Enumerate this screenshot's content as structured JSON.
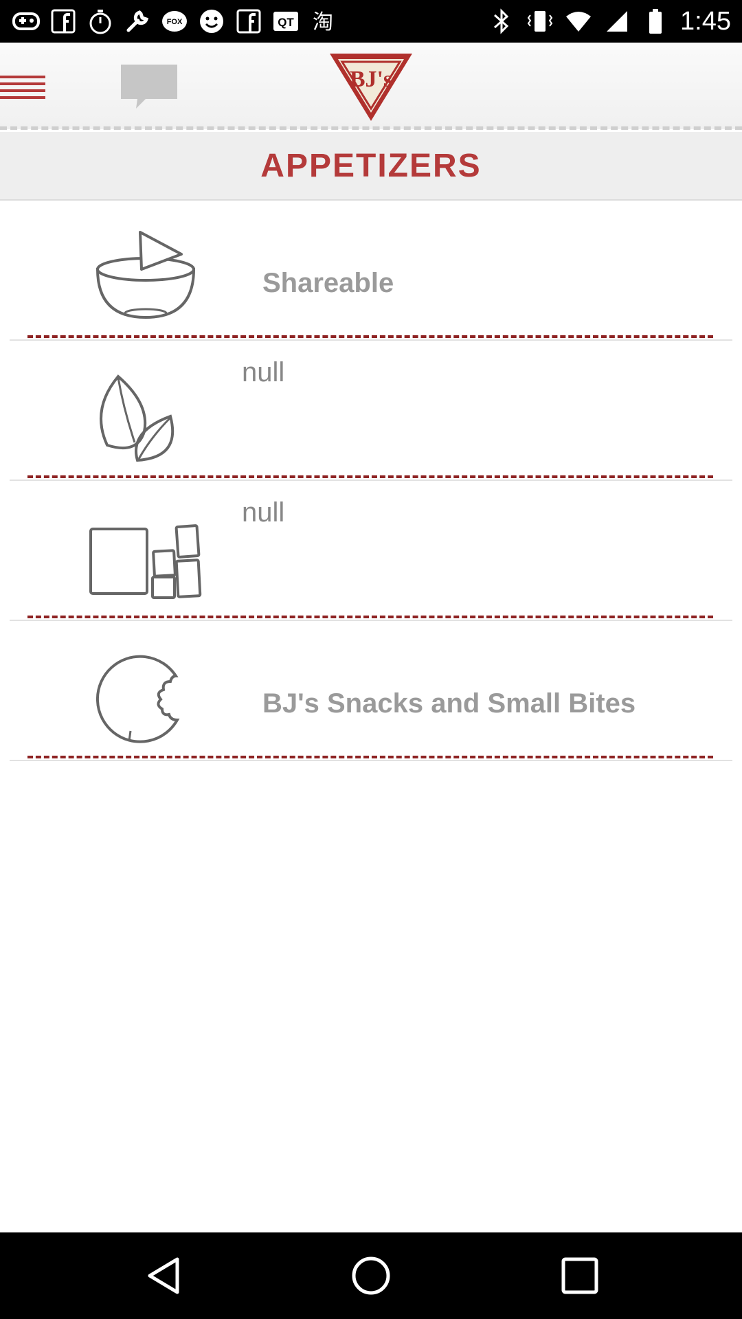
{
  "status_bar": {
    "time": "1:45",
    "icons": [
      "gamepad-icon",
      "facebook-icon",
      "stopwatch-icon",
      "wrench-icon",
      "fox-sports-icon",
      "smiley-icon",
      "facebook-icon",
      "qt-icon",
      "taobao-icon",
      "bluetooth-icon",
      "vibrate-icon",
      "wifi-icon",
      "signal-icon",
      "battery-icon"
    ]
  },
  "header": {
    "logo_text": "BJ's",
    "menu_icon": "hamburger-menu-icon",
    "chat_icon": "chat-bubble-icon",
    "colors": {
      "accent": "#b43a3a",
      "logo_red": "#b0302c"
    }
  },
  "page": {
    "title": "APPETIZERS"
  },
  "categories": [
    {
      "label": "Shareable",
      "icon": "bowl-chip-icon"
    },
    {
      "label": "null",
      "icon": "leaf-icon"
    },
    {
      "label": "null",
      "icon": "tiles-icon"
    },
    {
      "label": "BJ's Snacks and Small Bites",
      "icon": "bitten-cookie-icon"
    }
  ],
  "nav_bar": {
    "icons": [
      "back-icon",
      "home-icon",
      "recents-icon"
    ]
  }
}
